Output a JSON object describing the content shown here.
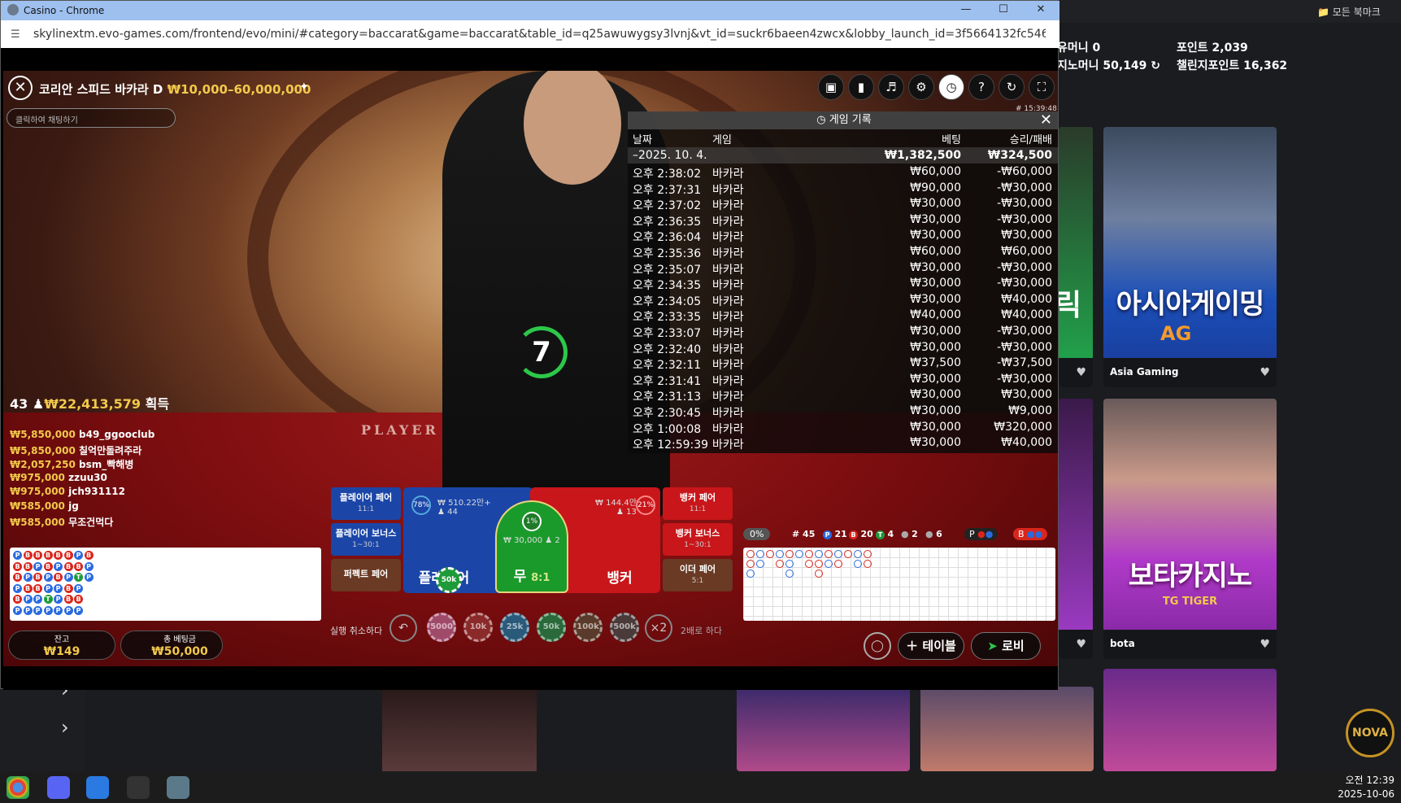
{
  "window": {
    "title": "Casino - Chrome",
    "url": "skylinextm.evo-games.com/frontend/evo/mini/#category=baccarat&game=baccarat&table_id=q25awuwygsy3lvnj&vt_id=suckr6baeen4zwcx&lobby_launch_id=3f5664132fc5463b90b0df07cbf705..."
  },
  "bookmarks": {
    "label": "모든 북마크"
  },
  "account": {
    "money_label": "유머니 0",
    "casino_money": "지노머니 50,149",
    "points": "포인트 2,039",
    "challenge_points": "챌린지포인트 16,362"
  },
  "lobby": {
    "cards": [
      {
        "name": "Asia Gaming",
        "art_text": "아시아게이밍",
        "logo": "AG"
      },
      {
        "name": "bota",
        "art_text": "보타카지노",
        "logo": "TG TIGER"
      }
    ],
    "side_text": "릭",
    "brand": "NOVA"
  },
  "game": {
    "table_name": "코리안 스피드 바카라 D",
    "limits": "₩10,000–60,000,000",
    "chat_placeholder": "클릭하여 채팅하기",
    "clock": "# 15:39:48",
    "timer": "7",
    "table_word": "PLAYER",
    "winners_count": "43",
    "winners_total": "₩22,413,579",
    "winners_label": "획득",
    "winners": [
      {
        "amount": "₩5,850,000",
        "name": "b49_ggooclub"
      },
      {
        "amount": "₩5,850,000",
        "name": "칠억만돌려주라"
      },
      {
        "amount": "₩2,057,250",
        "name": "bsm_빡해병"
      },
      {
        "amount": "₩975,000",
        "name": "zzuu30"
      },
      {
        "amount": "₩975,000",
        "name": "jch931112"
      },
      {
        "amount": "₩585,000",
        "name": "jg"
      },
      {
        "amount": "₩585,000",
        "name": "무조건먹다"
      }
    ]
  },
  "history": {
    "title": "게임 기록",
    "col_date": "날짜",
    "col_game": "게임",
    "col_bet": "베팅",
    "col_result": "승리/패배",
    "summary": {
      "date": "–2025. 10. 4.",
      "bet": "₩1,382,500",
      "result": "₩324,500"
    },
    "rows": [
      {
        "time": "오후 2:38:02",
        "game": "바카라",
        "bet": "₩60,000",
        "result": "-₩60,000"
      },
      {
        "time": "오후 2:37:31",
        "game": "바카라",
        "bet": "₩90,000",
        "result": "-₩30,000"
      },
      {
        "time": "오후 2:37:02",
        "game": "바카라",
        "bet": "₩30,000",
        "result": "-₩30,000"
      },
      {
        "time": "오후 2:36:35",
        "game": "바카라",
        "bet": "₩30,000",
        "result": "-₩30,000"
      },
      {
        "time": "오후 2:36:04",
        "game": "바카라",
        "bet": "₩30,000",
        "result": "₩30,000"
      },
      {
        "time": "오후 2:35:36",
        "game": "바카라",
        "bet": "₩60,000",
        "result": "₩60,000"
      },
      {
        "time": "오후 2:35:07",
        "game": "바카라",
        "bet": "₩30,000",
        "result": "-₩30,000"
      },
      {
        "time": "오후 2:34:35",
        "game": "바카라",
        "bet": "₩30,000",
        "result": "-₩30,000"
      },
      {
        "time": "오후 2:34:05",
        "game": "바카라",
        "bet": "₩30,000",
        "result": "₩40,000"
      },
      {
        "time": "오후 2:33:35",
        "game": "바카라",
        "bet": "₩40,000",
        "result": "₩40,000"
      },
      {
        "time": "오후 2:33:07",
        "game": "바카라",
        "bet": "₩30,000",
        "result": "-₩30,000"
      },
      {
        "time": "오후 2:32:40",
        "game": "바카라",
        "bet": "₩30,000",
        "result": "-₩30,000"
      },
      {
        "time": "오후 2:32:11",
        "game": "바카라",
        "bet": "₩37,500",
        "result": "-₩37,500"
      },
      {
        "time": "오후 2:31:41",
        "game": "바카라",
        "bet": "₩30,000",
        "result": "-₩30,000"
      },
      {
        "time": "오후 2:31:13",
        "game": "바카라",
        "bet": "₩30,000",
        "result": "₩30,000"
      },
      {
        "time": "오후 2:30:45",
        "game": "바카라",
        "bet": "₩30,000",
        "result": "₩9,000"
      },
      {
        "time": "오후 1:00:08",
        "game": "바카라",
        "bet": "₩30,000",
        "result": "₩320,000"
      },
      {
        "time": "오후 12:59:39",
        "game": "바카라",
        "bet": "₩30,000",
        "result": "₩40,000"
      }
    ]
  },
  "road": {
    "pct": "0%",
    "rounds": "# 45",
    "p_count": "21",
    "b_count": "20",
    "t_count": "4",
    "pp_count": "2",
    "bp_count": "6",
    "p_label": "P",
    "b_label": "B",
    "t_label": "T"
  },
  "bets": {
    "player_pair": "플레이어 페어",
    "player_pair_odds": "11:1",
    "player_bonus": "플레이어 보너스",
    "player_bonus_odds": "1~30:1",
    "perfect_pair": "퍼펙트 페어",
    "banker_pair": "뱅커 페어",
    "banker_pair_odds": "11:1",
    "banker_bonus": "뱅커 보너스",
    "banker_bonus_odds": "1~30:1",
    "either_pair": "이더 페어",
    "either_pair_odds": "5:1",
    "player": "플레이어",
    "player_pct": "78%",
    "player_total": "₩ 510.22만+",
    "player_count": "44",
    "tie": "무",
    "tie_odds": "8:1",
    "tie_pct": "1%",
    "tie_total": "₩ 30,000",
    "tie_count": "2",
    "banker": "뱅커",
    "banker_pct": "21%",
    "banker_total": "₩ 144.4만",
    "banker_count": "13",
    "player_chip": "50k"
  },
  "chips": {
    "undo": "실행 취소하다",
    "values": [
      "5000",
      "10k",
      "25k",
      "50k",
      "100k",
      "500k"
    ],
    "double": "×2",
    "double_label": "2배로 하다"
  },
  "balance": {
    "label": "잔고",
    "value": "₩149",
    "bet_label": "총 베팅금",
    "bet_value": "₩50,000"
  },
  "buttons": {
    "table": "테이블",
    "lobby": "로비"
  },
  "taskbar": {
    "time": "오전 12:39",
    "date": "2025-10-06"
  }
}
